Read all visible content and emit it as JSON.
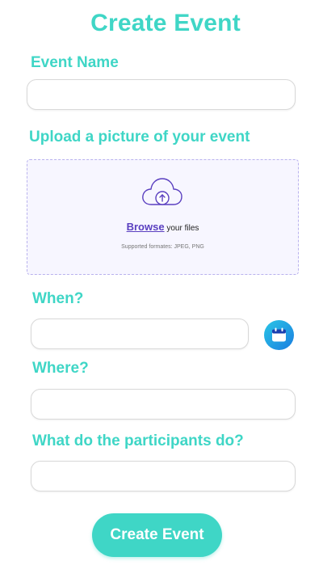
{
  "page": {
    "title": "Create Event"
  },
  "fields": {
    "event_name_label": "Event Name",
    "event_name_value": "",
    "upload_label": "Upload a picture of your event",
    "when_label": "When?",
    "when_value": "",
    "where_label": "Where?",
    "where_value": "",
    "activity_label": "What do the participants do?",
    "activity_value": ""
  },
  "upload": {
    "browse_link": "Browse",
    "browse_suffix": "your files",
    "formats": "Supported formates: JPEG, PNG",
    "icon": "cloud-upload-icon"
  },
  "calendar": {
    "icon": "calendar-icon"
  },
  "submit": {
    "label": "Create Event"
  },
  "colors": {
    "accent": "#3fd6c6",
    "upload_border": "#b9b2ee",
    "upload_bg": "#f7f6ff",
    "link": "#5a3fc0",
    "calendar_gradient_start": "#2ac6e6",
    "calendar_gradient_end": "#1a7de0"
  }
}
